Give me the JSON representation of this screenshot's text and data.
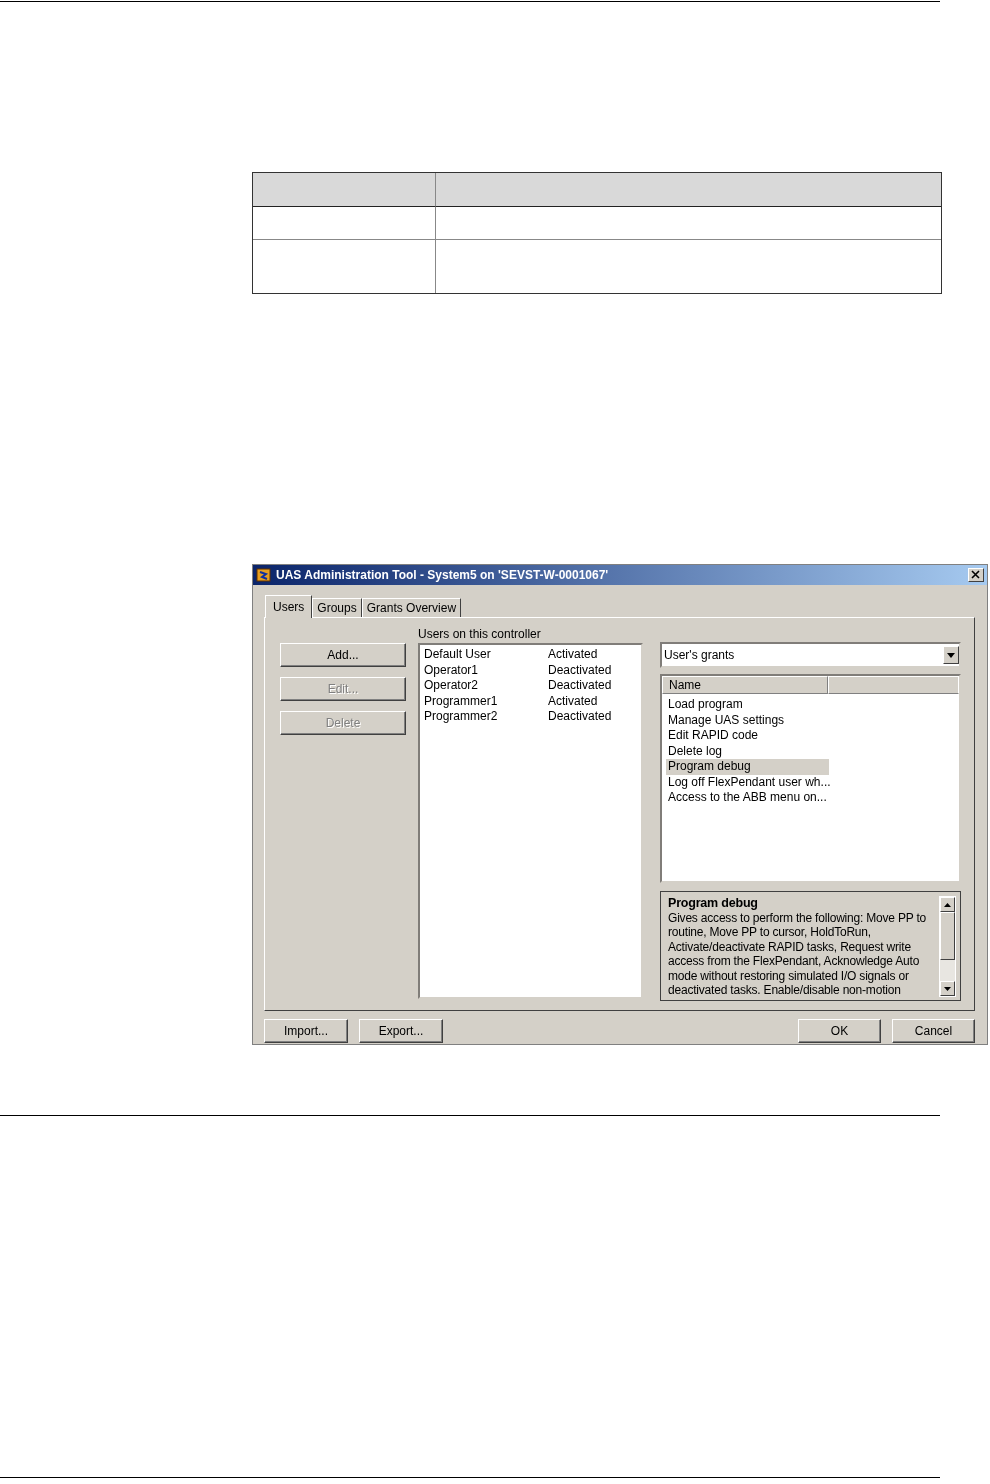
{
  "window": {
    "title": "UAS Administration Tool - System5 on 'SEVST-W-0001067'"
  },
  "tabs": [
    {
      "label": "Users",
      "selected": true
    },
    {
      "label": "Groups",
      "selected": false
    },
    {
      "label": "Grants Overview",
      "selected": false
    }
  ],
  "user_buttons": [
    {
      "label": "Add...",
      "disabled": false
    },
    {
      "label": "Edit...",
      "disabled": true
    },
    {
      "label": "Delete",
      "disabled": true
    }
  ],
  "users": {
    "label": "Users on this controller",
    "rows": [
      {
        "name": "Default User",
        "status": "Activated"
      },
      {
        "name": "Operator1",
        "status": "Deactivated"
      },
      {
        "name": "Operator2",
        "status": "Deactivated"
      },
      {
        "name": "Programmer1",
        "status": "Activated"
      },
      {
        "name": "Programmer2",
        "status": "Deactivated"
      }
    ]
  },
  "view_select": {
    "value": "User's grants"
  },
  "grants": {
    "columns": [
      "Name"
    ],
    "rows": [
      {
        "name": "Load program",
        "selected": false
      },
      {
        "name": "Manage UAS settings",
        "selected": false
      },
      {
        "name": "Edit RAPID code",
        "selected": false
      },
      {
        "name": "Delete log",
        "selected": false
      },
      {
        "name": "Program debug",
        "selected": true
      },
      {
        "name": "Log off FlexPendant user wh...",
        "selected": false
      },
      {
        "name": "Access to the ABB menu on...",
        "selected": false
      }
    ]
  },
  "description": {
    "title": "Program debug",
    "text": "Gives access to perform the following: Move PP to routine, Move PP to cursor, HoldToRun, Activate/deactivate RAPID tasks, Request write access from the FlexPendant, Acknowledge Auto mode without restoring simulated I/O signals or deactivated tasks. Enable/disable non-motion"
  },
  "footer_buttons_left": [
    "Import...",
    "Export..."
  ],
  "footer_buttons_right": [
    "OK",
    "Cancel"
  ]
}
